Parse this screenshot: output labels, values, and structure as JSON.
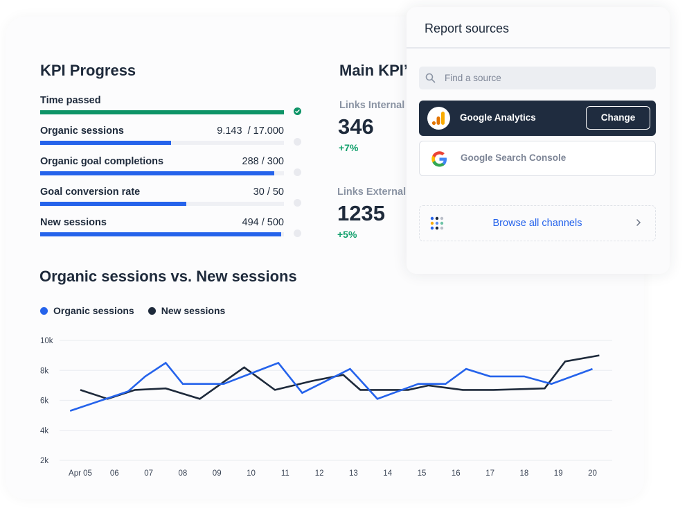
{
  "kpi_progress": {
    "title": "KPI Progress",
    "items": [
      {
        "label": "Time passed",
        "value": "",
        "progress": 1.0,
        "status": "complete",
        "color": "#0e9467"
      },
      {
        "label": "Organic sessions",
        "value": "9.143  / 17.000",
        "progress": 0.5378,
        "status": "pending",
        "color": "#2563eb"
      },
      {
        "label": "Organic goal completions",
        "value": "288 / 300",
        "progress": 0.96,
        "status": "pending",
        "color": "#2563eb"
      },
      {
        "label": "Goal conversion rate",
        "value": "30 / 50",
        "progress": 0.6,
        "status": "pending",
        "color": "#2563eb"
      },
      {
        "label": "New sessions",
        "value": "494 / 500",
        "progress": 0.988,
        "status": "pending",
        "color": "#2563eb"
      }
    ]
  },
  "main_kpis": {
    "title": "Main KPI’s",
    "items": [
      {
        "label": "Links Internal",
        "value": "346",
        "delta": "+7%"
      },
      {
        "label": "Links External",
        "value": "1235",
        "delta": "+5%"
      }
    ]
  },
  "report_sources": {
    "title": "Report sources",
    "search_placeholder": "Find a source",
    "sources": [
      {
        "name": "Google Analytics",
        "icon": "google-analytics-icon",
        "active": true,
        "action_label": "Change"
      },
      {
        "name": "Google Search Console",
        "icon": "google-g-icon",
        "active": false
      }
    ],
    "browse_label": "Browse all channels"
  },
  "colors": {
    "organic": "#2563eb",
    "new": "#1e2a3b",
    "positive": "#12a06c",
    "complete": "#0e9467"
  },
  "chart_data": {
    "type": "line",
    "title": "Organic sessions vs. New sessions",
    "xlabel": "",
    "ylabel": "",
    "ylim": [
      2000,
      10000
    ],
    "yticks": [
      2000,
      4000,
      6000,
      8000,
      10000
    ],
    "ytick_labels": [
      "2k",
      "4k",
      "6k",
      "8k",
      "10k"
    ],
    "x_tick_labels": [
      "Apr 05",
      "06",
      "07",
      "08",
      "09",
      "10",
      "11",
      "12",
      "13",
      "14",
      "15",
      "16",
      "17",
      "18",
      "19",
      "20"
    ],
    "x_range": [
      0,
      15.5
    ],
    "grid": true,
    "legend": "top-left",
    "series": [
      {
        "name": "Organic sessions",
        "color": "#2563eb",
        "points": [
          [
            -0.3,
            5300
          ],
          [
            1.4,
            6600
          ],
          [
            1.9,
            7600
          ],
          [
            2.5,
            8500
          ],
          [
            3.0,
            7100
          ],
          [
            4.2,
            7100
          ],
          [
            5.8,
            8500
          ],
          [
            6.5,
            6500
          ],
          [
            7.9,
            8100
          ],
          [
            8.7,
            6100
          ],
          [
            9.9,
            7100
          ],
          [
            10.7,
            7100
          ],
          [
            11.3,
            8100
          ],
          [
            12.0,
            7600
          ],
          [
            13.0,
            7600
          ],
          [
            13.8,
            7100
          ],
          [
            15.0,
            8100
          ]
        ]
      },
      {
        "name": "New sessions",
        "color": "#1e2a3b",
        "points": [
          [
            0.0,
            6700
          ],
          [
            0.8,
            6100
          ],
          [
            1.6,
            6700
          ],
          [
            2.5,
            6800
          ],
          [
            3.5,
            6100
          ],
          [
            4.8,
            8200
          ],
          [
            5.7,
            6700
          ],
          [
            6.8,
            7300
          ],
          [
            7.7,
            7700
          ],
          [
            8.2,
            6700
          ],
          [
            9.6,
            6700
          ],
          [
            10.2,
            7000
          ],
          [
            11.2,
            6700
          ],
          [
            12.1,
            6700
          ],
          [
            13.6,
            6800
          ],
          [
            14.2,
            8600
          ],
          [
            15.2,
            9000
          ]
        ]
      }
    ]
  }
}
